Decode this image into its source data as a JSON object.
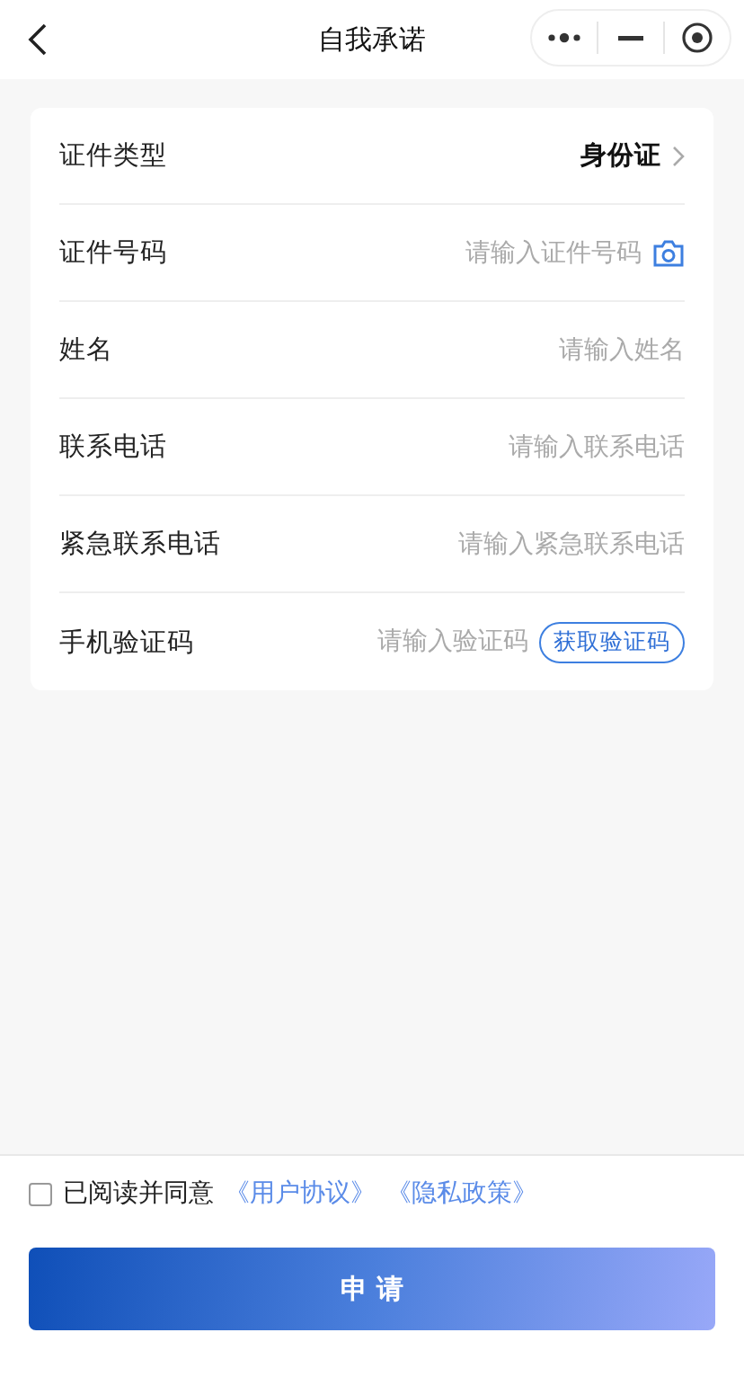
{
  "header": {
    "title": "自我承诺"
  },
  "form_rows": [
    {
      "kind": "select",
      "label": "证件类型",
      "value": "身份证"
    },
    {
      "kind": "scan",
      "label": "证件号码",
      "placeholder": "请输入证件号码"
    },
    {
      "kind": "input",
      "label": "姓名",
      "placeholder": "请输入姓名"
    },
    {
      "kind": "input",
      "label": "联系电话",
      "placeholder": "请输入联系电话"
    },
    {
      "kind": "input",
      "label": "紧急联系电话",
      "placeholder": "请输入紧急联系电话"
    },
    {
      "kind": "code",
      "label": "手机验证码",
      "placeholder": "请输入验证码",
      "button": "获取验证码"
    }
  ],
  "agreement": {
    "checked": false,
    "text": "已阅读并同意",
    "links": [
      "《用户协议》",
      "《隐私政策》"
    ]
  },
  "submit_button": "申 请"
}
